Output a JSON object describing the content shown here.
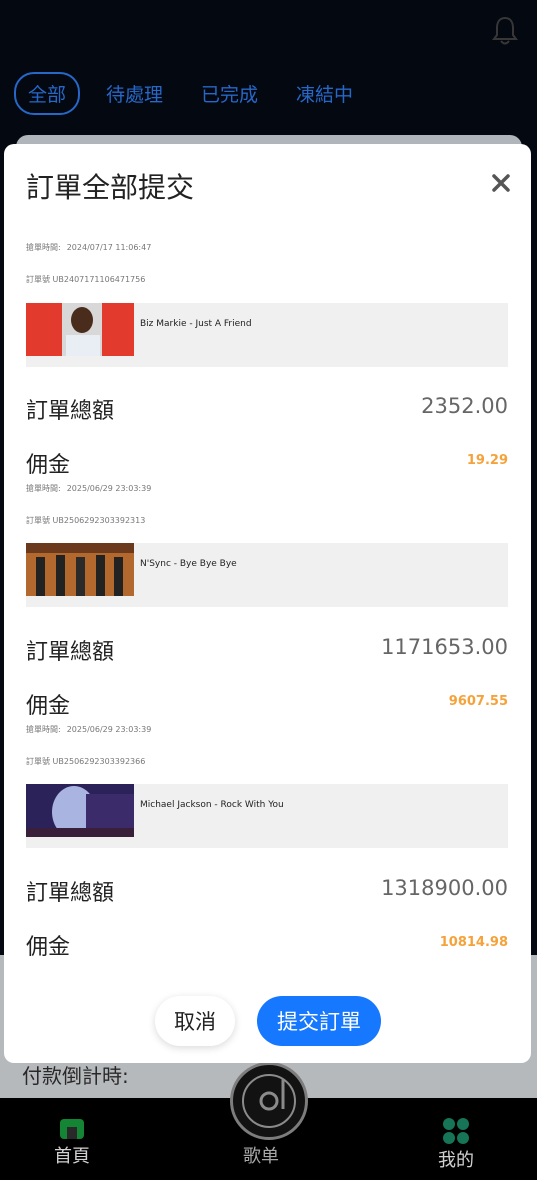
{
  "background": {
    "tabs": [
      {
        "label": "全部",
        "active": true
      },
      {
        "label": "待處理",
        "active": false
      },
      {
        "label": "已完成",
        "active": false
      },
      {
        "label": "凍結中",
        "active": false
      }
    ],
    "countdown_label": "付款倒計時:"
  },
  "nav": {
    "home_label": "首頁",
    "songs_label": "歌单",
    "mine_label": "我的"
  },
  "modal": {
    "title": "訂單全部提交",
    "orders": [
      {
        "time_label": "搶單時間:",
        "time_value": "2024/07/17 11:06:47",
        "order_no_label": "訂單號",
        "order_no": "UB2407171106471756",
        "song": "Biz Markie - Just A Friend",
        "total_label": "訂單總額",
        "total": "2352.00",
        "commission_label": "佣金",
        "commission": "19.29"
      },
      {
        "time_label": "搶單時間:",
        "time_value": "2025/06/29 23:03:39",
        "order_no_label": "訂單號",
        "order_no": "UB2506292303392313",
        "song": "N'Sync - Bye Bye Bye",
        "total_label": "訂單總額",
        "total": "1171653.00",
        "commission_label": "佣金",
        "commission": "9607.55"
      },
      {
        "time_label": "搶單時間:",
        "time_value": "2025/06/29 23:03:39",
        "order_no_label": "訂單號",
        "order_no": "UB2506292303392366",
        "song": "Michael Jackson - Rock With You",
        "total_label": "訂單總額",
        "total": "1318900.00",
        "commission_label": "佣金",
        "commission": "10814.98"
      }
    ],
    "cancel_label": "取消",
    "submit_label": "提交訂單"
  },
  "colors": {
    "accent": "#1677ff",
    "commission": "#f5a23a"
  }
}
